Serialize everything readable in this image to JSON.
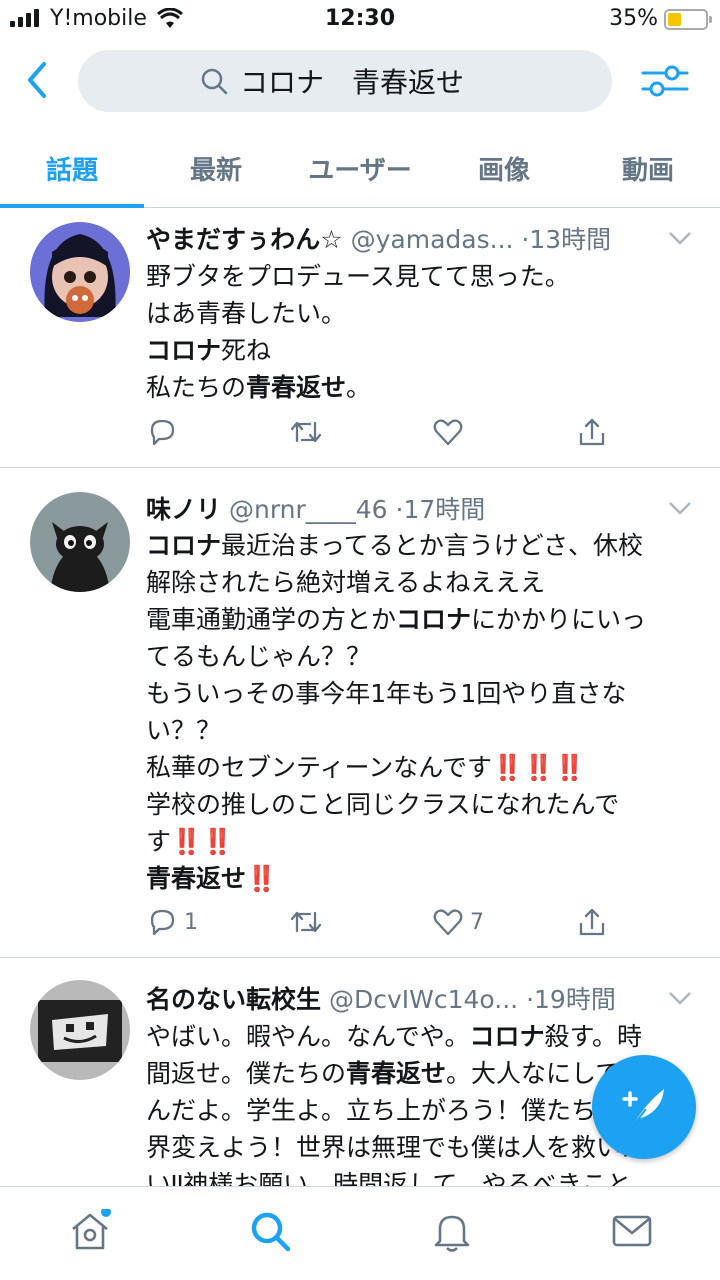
{
  "status": {
    "carrier": "Y!mobile",
    "time": "12:30",
    "battery": "35%"
  },
  "search": {
    "query": "コロナ　青春返せ"
  },
  "tabs": [
    "話題",
    "最新",
    "ユーザー",
    "画像",
    "動画"
  ],
  "tweets": [
    {
      "name": "やまだすぅわん☆",
      "handle": "@yamadas...",
      "time": "·13時間",
      "lines": [
        "野ブタをプロデュース見てて思った。",
        "はあ青春したい。",
        "<b>コロナ</b>死ね",
        "私たちの<b>青春返せ</b>。"
      ],
      "reply": "",
      "like": ""
    },
    {
      "name": "味ノリ",
      "handle": "@nrnr____46",
      "time": "·17時間",
      "lines": [
        "<b>コロナ</b>最近治まってるとか言うけどさ、休校",
        "解除されたら絶対増えるよねえええ",
        "電車通勤通学の方とか<b>コロナ</b>にかかりにいっ",
        "てるもんじゃん？？",
        "もういっその事今年1年もう1回やり直さな",
        "い？？",
        "私華のセブンティーンなんです<span class=\"bang\">‼️‼️‼️</span>",
        "学校の推しのこと同じクラスになれたんで",
        "す<span class=\"bang\">‼️‼️</span>",
        "<b>青春返せ</b><span class=\"bang\">‼️</span>"
      ],
      "reply": "1",
      "like": "7"
    },
    {
      "name": "名のない転校生",
      "handle": "@DcvIWc14o...",
      "time": "·19時間",
      "lines": [
        "やばい。暇やん。なんでや。<b>コロナ</b>殺す。時",
        "間返せ。僕たちの<b>青春返せ</b>。大人なにしてる",
        "んだよ。学生よ。立ち上がろう！僕たちで世",
        "界変えよう！世界は無理でも僕は人を救いた",
        "い‼︎神様お願い。時間返して。やるべきこと"
      ],
      "reply": "",
      "like": ""
    }
  ],
  "colors": {
    "accent": "#1da1f2",
    "text": "#14171a",
    "muted": "#657786",
    "alert": "#e0245e"
  },
  "icons": [
    "back-icon",
    "search-icon",
    "filter-icon",
    "reply-icon",
    "retweet-icon",
    "like-icon",
    "share-icon",
    "compose-icon",
    "home-icon",
    "explore-icon",
    "notifications-icon",
    "messages-icon"
  ]
}
